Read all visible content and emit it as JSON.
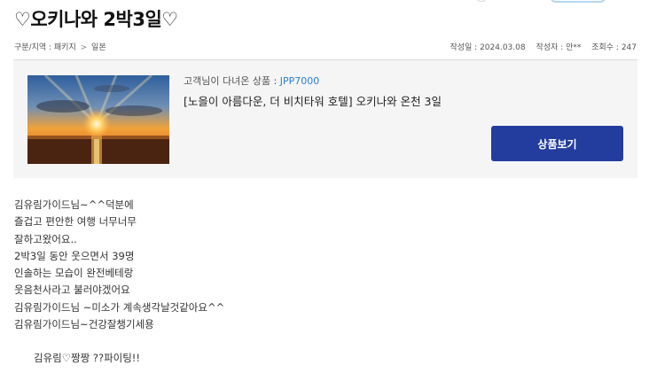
{
  "title": "♡오키나와 2박3일♡",
  "breadcrumb": {
    "label": "구분/지역 : 패키지",
    "separator": ">",
    "region": "일본"
  },
  "meta": {
    "date": "작성일 : 2024.03.08",
    "author": "작성자 : 안**",
    "views": "조회수 : 247"
  },
  "product": {
    "label": "고객님이 다녀온 상품 : ",
    "code": "JPP7000",
    "name": "[노을이 아름다운, 더 비치타워 호텔] 오키나와 온천 3일",
    "button": "상품보기",
    "thumbnail_icon": "sunset-photo"
  },
  "body": {
    "lines": [
      "김유림가이드님~^^덕분에",
      "즐겁고 편안한 여행 너무너무",
      "잘하고왔어요..",
      "2박3일 동안 웃으면서 39명",
      "인솔하는 모습이 완전베테랑",
      "웃음천사라고 불러야겠어요",
      "김유림가이드님 ~미소가 계속생각날것같아요^^",
      "김유림가이드님~건강잘챙기세용"
    ],
    "closing": "김유림♡짱짱 ??파이팅!!"
  }
}
